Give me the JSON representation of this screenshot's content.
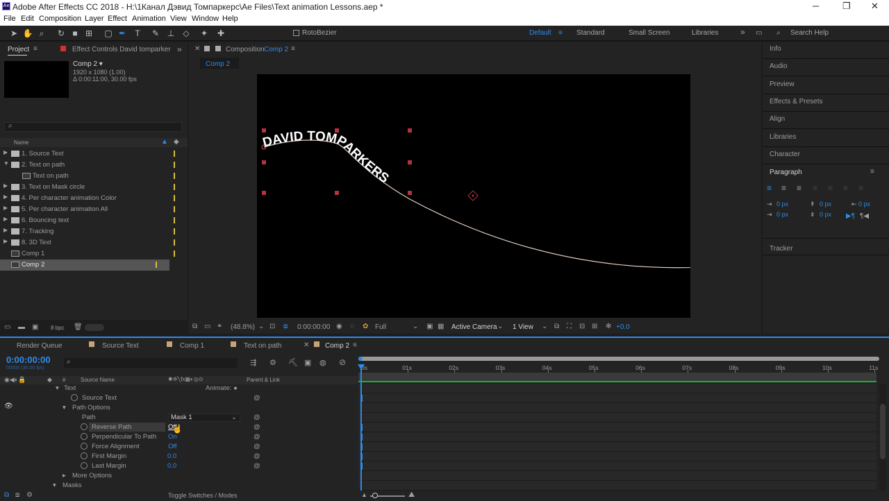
{
  "window": {
    "title": "Adobe After Effects CC 2018 - H:\\1Канал Дэвид Томпаркерс\\Ae Files\\Text animation Lessons.aep *",
    "app_icon": "Ae",
    "min": "─",
    "max": "❐",
    "close": "✕"
  },
  "menu": [
    "File",
    "Edit",
    "Composition",
    "Layer",
    "Effect",
    "Animation",
    "View",
    "Window",
    "Help"
  ],
  "toolbar": {
    "rotobezier": "RotoBezier",
    "workspaces": [
      "Default",
      "Standard",
      "Small Screen",
      "Libraries"
    ],
    "active_workspace": "Default",
    "search_placeholder": "Search Help"
  },
  "project": {
    "tab": "Project",
    "effect_controls": "Effect Controls David tomparker",
    "comp_name": "Comp 2 ▾",
    "comp_res": "1920 x 1080 (1.00)",
    "comp_dur": "Δ 0:00:11:00, 30.00 fps",
    "col_name": "Name",
    "bpc": "8 bpc",
    "items": [
      {
        "label": "1. Source Text",
        "type": "folder"
      },
      {
        "label": "2. Text on path",
        "type": "folder-open"
      },
      {
        "label": "Text on path",
        "type": "comp",
        "indent": true
      },
      {
        "label": "3. Text on Mask circle",
        "type": "folder"
      },
      {
        "label": "4. Per character animation Color",
        "type": "folder"
      },
      {
        "label": "5. Per character animation All",
        "type": "folder"
      },
      {
        "label": "6. Bouncing text",
        "type": "folder"
      },
      {
        "label": "7. Tracking",
        "type": "folder"
      },
      {
        "label": "8. 3D Text",
        "type": "folder"
      },
      {
        "label": "Comp 1",
        "type": "comp"
      },
      {
        "label": "Comp 2",
        "type": "comp",
        "selected": true
      }
    ]
  },
  "composition": {
    "tab_label": "Composition",
    "tab_name": "Comp 2",
    "flow_tab": "Comp 2",
    "text1": "DAVID TO",
    "text2": "MPARKERS",
    "zoom": "(48.8%)",
    "time": "0:00:00:00",
    "resolution": "Full",
    "camera": "Active Camera",
    "view": "1 View",
    "exposure": "+0.0"
  },
  "right_panels": [
    "Info",
    "Audio",
    "Preview",
    "Effects & Presets",
    "Align",
    "Libraries",
    "Character"
  ],
  "paragraph": {
    "title": "Paragraph",
    "px": [
      "0 px",
      "0 px",
      "0 px",
      "0 px",
      "0 px"
    ]
  },
  "tracker": "Tracker",
  "timeline": {
    "tabs": [
      "Render Queue",
      "Source Text",
      "Comp 1",
      "Text on path",
      "Comp 2"
    ],
    "active_tab": "Comp 2",
    "timecode": "0:00:00:00",
    "timecode_sub": "00000 (30.00 fps)",
    "col_source": "Source Name",
    "col_parent": "Parent & Link",
    "animate": "Animate: ●",
    "rows": {
      "text": "Text",
      "source_text": "Source Text",
      "path_options": "Path Options",
      "path": "Path",
      "path_val": "Mask 1",
      "reverse": "Reverse Path",
      "reverse_val": "Off",
      "perp": "Perpendicular To Path",
      "perp_val": "On",
      "force": "Force Alignment",
      "force_val": "Off",
      "first": "First Margin",
      "first_val": "0.0",
      "last": "Last Margin",
      "last_val": "0.0",
      "more": "More Options",
      "masks": "Masks"
    },
    "toggle": "Toggle Switches / Modes",
    "ruler": [
      "0s",
      "01s",
      "02s",
      "03s",
      "04s",
      "05s",
      "06s",
      "07s",
      "08s",
      "09s",
      "10s",
      "11s"
    ]
  }
}
